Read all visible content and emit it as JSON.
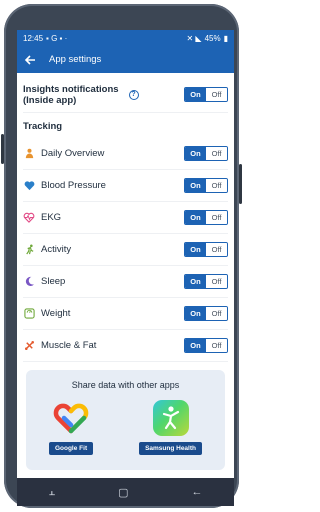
{
  "status": {
    "time": "12:45",
    "battery": "45%"
  },
  "appbar": {
    "title": "App settings"
  },
  "insights": {
    "label_line1": "Insights notifications",
    "label_line2": "(Inside app)"
  },
  "toggle": {
    "on": "On",
    "off": "Off"
  },
  "tracking": {
    "title": "Tracking",
    "items": [
      {
        "label": "Daily Overview",
        "icon": "person-icon",
        "color": "#e8932f"
      },
      {
        "label": "Blood Pressure",
        "icon": "heart-icon",
        "color": "#2a7fc9"
      },
      {
        "label": "EKG",
        "icon": "ekg-heart-icon",
        "color": "#e24a86"
      },
      {
        "label": "Activity",
        "icon": "running-icon",
        "color": "#6fa83a"
      },
      {
        "label": "Sleep",
        "icon": "moon-icon",
        "color": "#7a57c4"
      },
      {
        "label": "Weight",
        "icon": "scale-icon",
        "color": "#6fa83a"
      },
      {
        "label": "Muscle & Fat",
        "icon": "muscle-icon",
        "color": "#e45a2e"
      }
    ]
  },
  "share": {
    "title": "Share data with other apps",
    "google_fit": "Google Fit",
    "samsung_health": "Samsung Health"
  }
}
